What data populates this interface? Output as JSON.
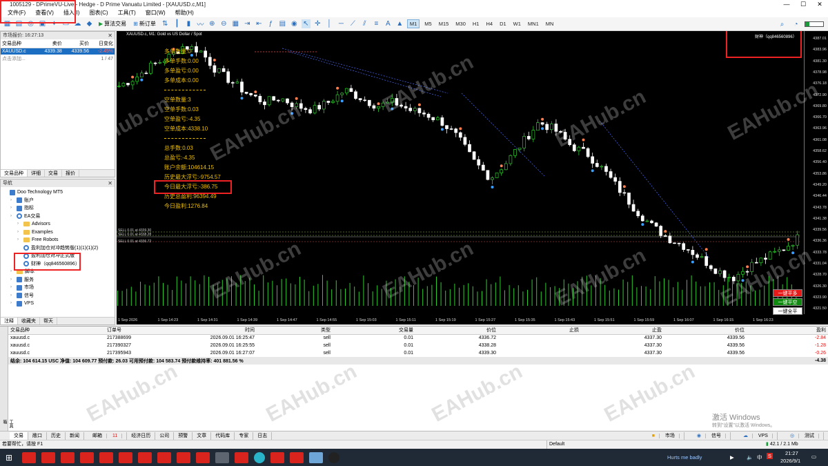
{
  "window": {
    "title": "1005129 - DPrimeVU-Live - Hedge - D Prime Vanuatu Limited - [XAUUSD.c,M1]",
    "controls": [
      "—",
      "☐",
      "✕"
    ]
  },
  "menu": [
    "文件(F)",
    "查看(V)",
    "插入(I)",
    "图表(C)",
    "工具(T)",
    "窗口(W)",
    "帮助(H)"
  ],
  "toolbar": {
    "algo_label": "算法交易",
    "new_order_label": "新订单",
    "timeframes": [
      "M1",
      "M5",
      "M15",
      "M30",
      "H1",
      "H4",
      "D1",
      "W1",
      "MN1",
      "MN"
    ],
    "active_timeframe": "M1"
  },
  "market_watch": {
    "header": "市场报价: 16:27:13",
    "columns": [
      "交易品种",
      "卖价",
      "买价",
      "日变化"
    ],
    "rows": [
      {
        "symbol": "XAUUSD.c",
        "bid": "4339.38",
        "ask": "4339.56",
        "change": "-2.45%"
      }
    ],
    "add_label": "点击添加...",
    "count": "1 / 47",
    "tabs": [
      "交易品种",
      "详细",
      "交易",
      "报价"
    ]
  },
  "navigator": {
    "header": "导航",
    "items": [
      {
        "label": "Doo Technology MT5",
        "level": 0,
        "kind": "root"
      },
      {
        "label": "账户",
        "level": 1,
        "kind": "acct"
      },
      {
        "label": "指标",
        "level": 1,
        "kind": "ind"
      },
      {
        "label": "EA交易",
        "level": 1,
        "kind": "ea"
      },
      {
        "label": "Advisors",
        "level": 2,
        "kind": "folder"
      },
      {
        "label": "Examples",
        "level": 2,
        "kind": "folder"
      },
      {
        "label": "Free Robots",
        "level": 2,
        "kind": "folder"
      },
      {
        "label": "盈利加仓对冲趋势版(1)(1)(1)(2)",
        "level": 2,
        "kind": "ea"
      },
      {
        "label": "盈利加仓对冲正式版",
        "level": 2,
        "kind": "ea"
      },
      {
        "label": "财神（qq846560896）",
        "level": 2,
        "kind": "ea"
      },
      {
        "label": "脚本",
        "level": 1,
        "kind": "folder"
      },
      {
        "label": "服务",
        "level": 1,
        "kind": "svc"
      },
      {
        "label": "市场",
        "level": 1,
        "kind": "mkt"
      },
      {
        "label": "信号",
        "level": 1,
        "kind": "sig"
      },
      {
        "label": "VPS",
        "level": 1,
        "kind": "vps"
      }
    ],
    "tabs": [
      "注释",
      "收藏夹",
      "帮天"
    ]
  },
  "chart": {
    "title": "XAUUSD.c, M1:  Gold vs US Dollar / Spot",
    "ea_label": "财神（qq846560896）",
    "stats_block1": [
      "多单数量:0",
      "多单手数:0.00",
      "多单盈亏:0.00",
      "多单成本:0.00"
    ],
    "stats_block2": [
      "空单数量:3",
      "空单手数:0.03",
      "空单盈亏:-4.35",
      "空单成本:4338.10"
    ],
    "stats_block3": [
      "总手数:0.03",
      "总盈亏:-4.35",
      "账户余额:104614.15",
      "历史最大浮亏:-9754.57",
      "今日最大浮亏:-386.75",
      "历史总盈利:96394.49",
      "今日盈利:1276.84"
    ],
    "order_lines": [
      "SELL 0.01 at 4339.30",
      "SELL 0.01 at 4338.28",
      "SELL 0.01 at 4336.72"
    ],
    "y_ticks": [
      "4387.01",
      "4383.96",
      "4381.30",
      "4378.98",
      "4376.18",
      "4372.90",
      "4369.80",
      "4366.70",
      "4363.96",
      "4361.08",
      "4358.62",
      "4356.40",
      "4353.86",
      "4349.20",
      "4346.44",
      "4343.78",
      "4341.38",
      "4339.56",
      "4336.36",
      "4333.78",
      "4331.04",
      "4328.70",
      "4326.30",
      "4323.90",
      "4321.50"
    ],
    "x_ticks": [
      "1 Sep 2026",
      "1 Sep 14:23",
      "1 Sep 14:31",
      "1 Sep 14:39",
      "1 Sep 14:47",
      "1 Sep 14:55",
      "1 Sep 15:03",
      "1 Sep 15:11",
      "1 Sep 15:19",
      "1 Sep 15:27",
      "1 Sep 15:35",
      "1 Sep 15:43",
      "1 Sep 15:51",
      "1 Sep 15:59",
      "1 Sep 16:07",
      "1 Sep 16:15",
      "1 Sep 16:23"
    ],
    "buttons": {
      "close_long": "一键平多",
      "close_short": "一键平空",
      "close_all": "一键全平"
    },
    "watermark": "EAHub.cn"
  },
  "chart_data": {
    "type": "candlestick",
    "title": "XAUUSD.c, M1:  Gold vs US Dollar / Spot",
    "xlabel": "",
    "ylabel": "",
    "ylim": [
      4320,
      4389
    ],
    "close_path": [
      4377,
      4379,
      4382,
      4384,
      4387,
      4386,
      4381,
      4378,
      4375,
      4373,
      4374,
      4372,
      4371,
      4373,
      4376,
      4374,
      4372,
      4373,
      4371,
      4370,
      4368,
      4364,
      4358,
      4354,
      4358,
      4363,
      4368,
      4366,
      4362,
      4360,
      4356,
      4351,
      4346,
      4342,
      4339,
      4337,
      4334,
      4331,
      4329,
      4332,
      4334,
      4336,
      4339
    ],
    "current_bid": 4339.56
  },
  "terminal": {
    "columns": [
      "交易品种",
      "订单号",
      "时间",
      "类型",
      "交易量",
      "价位",
      "止损",
      "止盈",
      "价位",
      "盈利"
    ],
    "rows": [
      {
        "symbol": "xauusd.c",
        "ticket": "217388699",
        "time": "2026.09.01 16:25:47",
        "type": "sell",
        "volume": "0.01",
        "price": "4336.72",
        "sl": "",
        "tp": "4337.30",
        "cur": "4339.56",
        "profit": "-2.84"
      },
      {
        "symbol": "xauusd.c",
        "ticket": "217390327",
        "time": "2026.09.01 16:25:55",
        "type": "sell",
        "volume": "0.01",
        "price": "4338.28",
        "sl": "",
        "tp": "4337.30",
        "cur": "4339.56",
        "profit": "-1.28"
      },
      {
        "symbol": "xauusd.c",
        "ticket": "217395943",
        "time": "2026.09.01 16:27:07",
        "type": "sell",
        "volume": "0.01",
        "price": "4339.30",
        "sl": "",
        "tp": "4337.30",
        "cur": "4339.56",
        "profit": "-0.26"
      }
    ],
    "summary": "结余: 104 614.15 USC  净值: 104 609.77  预付款: 26.03  可用预付款: 104 583.74  预付款维持率: 401 881.56 %",
    "summary_total": "-4.38",
    "tabs": [
      "交易",
      "敞口",
      "历史",
      "新闻",
      "邮箱",
      "经济日历",
      "公司",
      "预警",
      "文章",
      "代码库",
      "专家",
      "日志"
    ],
    "mail_count": "11",
    "side_label": "工具箱"
  },
  "status": {
    "left": "若要帮忙，请按 F1",
    "mid": "Default",
    "links": [
      "市场",
      "信号",
      "VPS",
      "测试"
    ],
    "net": "42.1 / 2.1 Mb",
    "activate": "激活 Windows",
    "activate_sub": "转到\"设置\"以激活 Windows。"
  },
  "taskbar": {
    "song": "Hurts me badly",
    "time": "21:27",
    "date": "2026/9/1",
    "ime": "中"
  }
}
